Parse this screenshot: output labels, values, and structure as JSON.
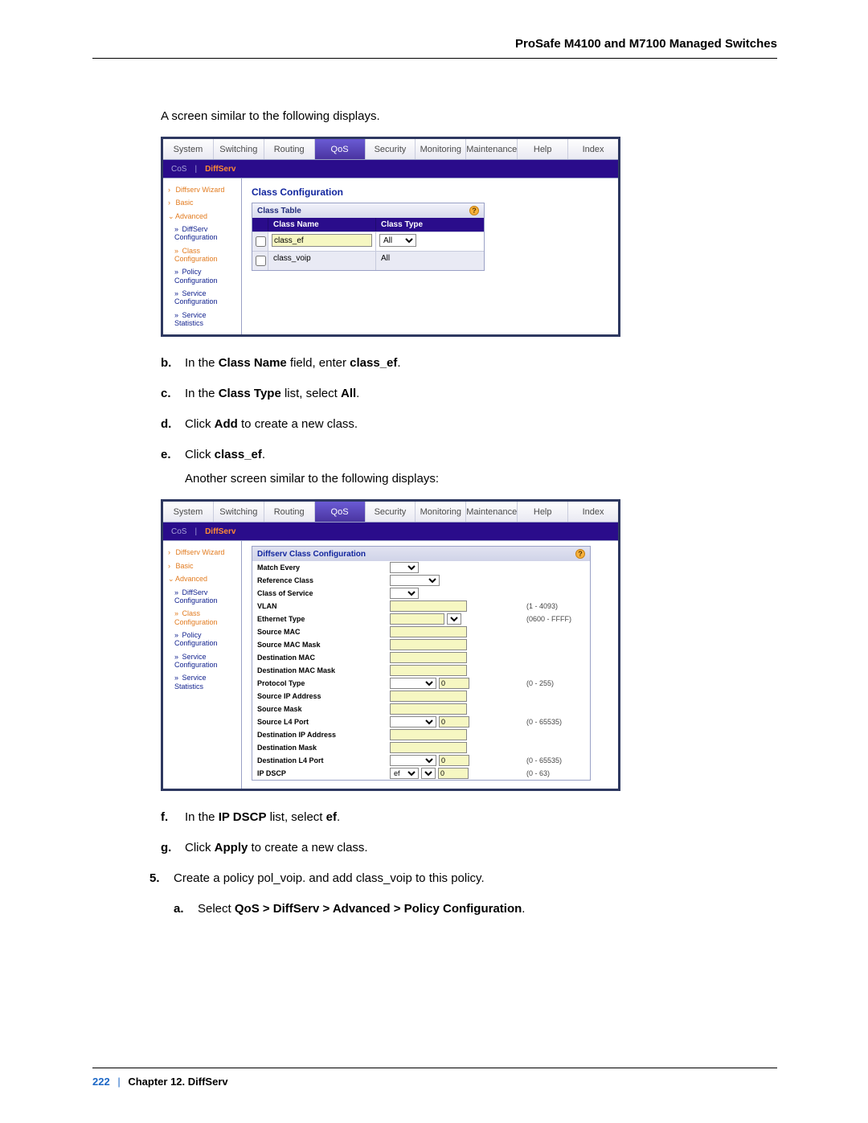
{
  "header": {
    "title": "ProSafe M4100 and M7100 Managed Switches"
  },
  "intro_text": "A screen similar to the following displays.",
  "fig1": {
    "menu": [
      "System",
      "Switching",
      "Routing",
      "QoS",
      "Security",
      "Monitoring",
      "Maintenance",
      "Help",
      "Index"
    ],
    "menu_active": "QoS",
    "submenu": {
      "muted": "CoS",
      "sep": "|",
      "active": "DiffServ"
    },
    "sidenav": [
      {
        "label": "Diffserv Wizard",
        "style": "orange",
        "caret": "›"
      },
      {
        "label": "Basic",
        "style": "orange",
        "caret": "›"
      },
      {
        "label": "Advanced",
        "style": "orange",
        "caret": "⌄"
      },
      {
        "label": "DiffServ Configuration",
        "style": "blue",
        "caret": "»",
        "indent": true
      },
      {
        "label": "Class Configuration",
        "style": "orange",
        "caret": "»",
        "indent": true
      },
      {
        "label": "Policy Configuration",
        "style": "blue",
        "caret": "»",
        "indent": true
      },
      {
        "label": "Service Configuration",
        "style": "blue",
        "caret": "»",
        "indent": true
      },
      {
        "label": "Service Statistics",
        "style": "blue",
        "caret": "»",
        "indent": true
      }
    ],
    "title": "Class Configuration",
    "table": {
      "heading": "Class Table",
      "columns": [
        "",
        "Class Name",
        "Class Type"
      ],
      "input_row": {
        "class_name": "class_ef",
        "class_type_selected": "All"
      },
      "rows": [
        {
          "class_name": "class_voip",
          "class_type": "All"
        }
      ]
    }
  },
  "steps_first": [
    {
      "marker": "b.",
      "html": "In the <b>Class Name</b> field, enter <b>class_ef</b>."
    },
    {
      "marker": "c.",
      "html": "In the <b>Class Type</b> list, select <b>All</b>."
    },
    {
      "marker": "d.",
      "html": "Click <b>Add</b> to create a new class."
    },
    {
      "marker": "e.",
      "html": "Click <b>class_ef</b>."
    }
  ],
  "mid_text": "Another screen similar to the following displays:",
  "fig2": {
    "menu": [
      "System",
      "Switching",
      "Routing",
      "QoS",
      "Security",
      "Monitoring",
      "Maintenance",
      "Help",
      "Index"
    ],
    "menu_active": "QoS",
    "submenu": {
      "muted": "CoS",
      "sep": "|",
      "active": "DiffServ"
    },
    "sidenav": [
      {
        "label": "Diffserv Wizard",
        "style": "orange",
        "caret": "›"
      },
      {
        "label": "Basic",
        "style": "orange",
        "caret": "›"
      },
      {
        "label": "Advanced",
        "style": "orange",
        "caret": "⌄"
      },
      {
        "label": "DiffServ Configuration",
        "style": "blue",
        "caret": "»",
        "indent": true
      },
      {
        "label": "Class Configuration",
        "style": "orange",
        "caret": "»",
        "indent": true
      },
      {
        "label": "Policy Configuration",
        "style": "blue",
        "caret": "»",
        "indent": true
      },
      {
        "label": "Service Configuration",
        "style": "blue",
        "caret": "»",
        "indent": true
      },
      {
        "label": "Service Statistics",
        "style": "blue",
        "caret": "»",
        "indent": true
      }
    ],
    "panel_title": "Diffserv Class Configuration",
    "fields": [
      {
        "label": "Match Every",
        "ctl": "select_small"
      },
      {
        "label": "Reference Class",
        "ctl": "select_med"
      },
      {
        "label": "Class of Service",
        "ctl": "select_small"
      },
      {
        "label": "VLAN",
        "ctl": "text_wide",
        "hint": "(1 - 4093)"
      },
      {
        "label": "Ethernet Type",
        "ctl": "text_sel",
        "hint": "(0600 - FFFF)"
      },
      {
        "label": "Source MAC",
        "ctl": "text_wide"
      },
      {
        "label": "Source MAC Mask",
        "ctl": "text_wide"
      },
      {
        "label": "Destination MAC",
        "ctl": "text_wide"
      },
      {
        "label": "Destination MAC Mask",
        "ctl": "text_wide"
      },
      {
        "label": "Protocol Type",
        "ctl": "sel_text",
        "val": "0",
        "hint": "(0 - 255)"
      },
      {
        "label": "Source IP Address",
        "ctl": "text_wide"
      },
      {
        "label": "Source Mask",
        "ctl": "text_wide"
      },
      {
        "label": "Source L4 Port",
        "ctl": "sel_text",
        "val": "0",
        "hint": "(0 - 65535)"
      },
      {
        "label": "Destination IP Address",
        "ctl": "text_wide"
      },
      {
        "label": "Destination Mask",
        "ctl": "text_wide"
      },
      {
        "label": "Destination L4 Port",
        "ctl": "sel_text",
        "val": "0",
        "hint": "(0 - 65535)"
      },
      {
        "label": "IP DSCP",
        "ctl": "ipdscp",
        "seltext": "ef",
        "val": "0",
        "hint": "(0 - 63)"
      }
    ]
  },
  "steps_second": [
    {
      "marker": "f.",
      "html": "In the <b>IP DSCP</b> list, select <b>ef</b>."
    },
    {
      "marker": "g.",
      "html": "Click <b>Apply</b> to create a new class."
    }
  ],
  "step5": {
    "marker": "5.",
    "text": "Create a policy pol_voip. and add class_voip to this policy."
  },
  "step5a": {
    "marker": "a.",
    "html": "Select <b>QoS > DiffServ > Advanced > Policy Configuration</b>."
  },
  "footer": {
    "page": "222",
    "sep": "|",
    "chapter": "Chapter 12.  DiffServ"
  }
}
